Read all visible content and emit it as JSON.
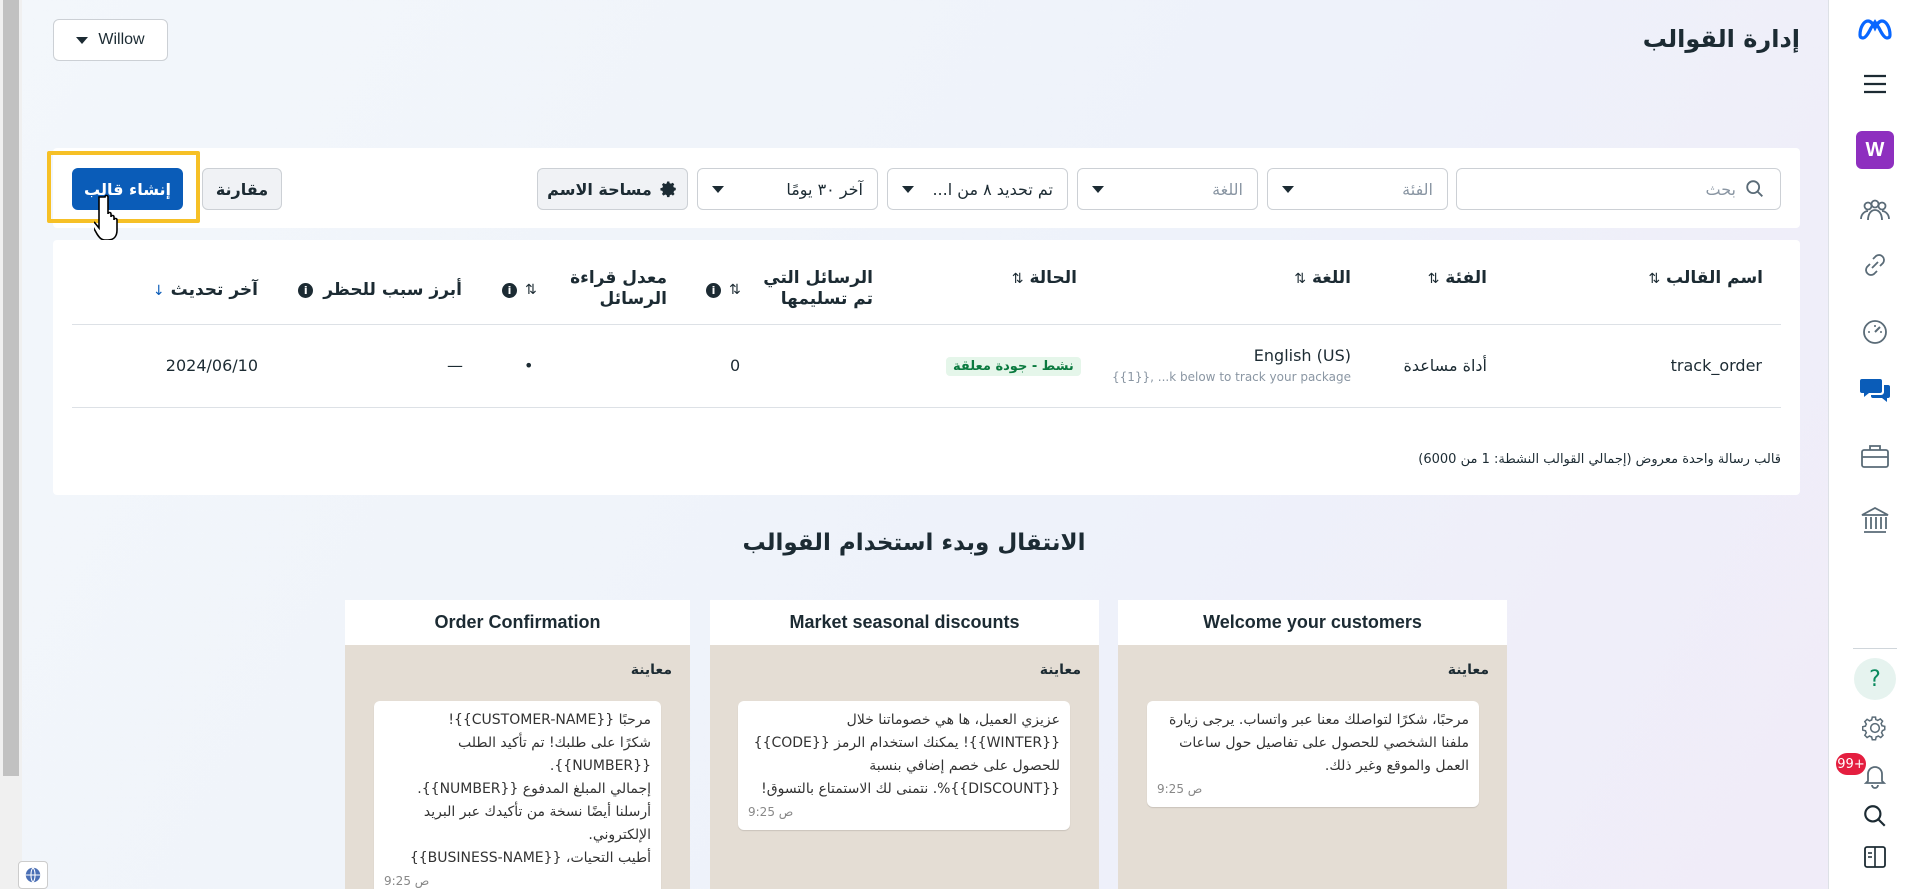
{
  "header": {
    "title": "إدارة القوالب",
    "account": "Willow"
  },
  "rail": {
    "workspace_letter": "W",
    "notification_count": "99+",
    "icons": [
      "meta-logo-icon",
      "menu-icon",
      "workspace-icon",
      "people-icon",
      "link-icon",
      "dashboard-gauge-icon",
      "chat-icon",
      "briefcase-icon",
      "bank-icon",
      "help-icon",
      "settings-icon",
      "bell-icon",
      "search-icon",
      "panel-icon"
    ]
  },
  "filters": {
    "search_placeholder": "بحث",
    "category_placeholder": "الفئة",
    "language_placeholder": "اللغة",
    "selected_value": "تم تحديد ٨ من ا...",
    "date_range": "آخر ٣٠ يومًا",
    "namespace_label": "مساحة الاسم",
    "compare_label": "مقارنة",
    "create_label": "إنشاء قالب"
  },
  "table": {
    "headers": {
      "name": "اسم القالب",
      "category": "الفئة",
      "language": "اللغة",
      "status": "الحالة",
      "delivered_line1": "الرسائل التي",
      "delivered_line2": "تم تسليمها",
      "readrate_line1": "معدل قراءة",
      "readrate_line2": "الرسائل",
      "block_reason": "أبرز سبب للحظر",
      "last_updated": "آخر تحديث"
    },
    "rows": [
      {
        "name": "track_order",
        "category": "أداة مساعدة",
        "language": "English (US)",
        "language_preview": "{{1}}, ...k below to track your package",
        "status": "نشط - جودة معلقة",
        "delivered": "0",
        "read_rate": "•",
        "block_reason": "—",
        "last_updated": "2024/06/10"
      }
    ],
    "footer": "قالب رسالة واحدة معروض (إجمالي القوالب النشطة: 1 من 6000)"
  },
  "templates_section": {
    "title": "الانتقال وبدء استخدام القوالب",
    "preview_label": "معاينة",
    "cards": [
      {
        "title": "Welcome your customers",
        "message": "مرحبًا، شكرًا لتواصلك معنا عبر واتساب. يرجى زيارة ملفنا الشخصي للحصول على تفاصيل حول ساعات العمل والموقع وغير ذلك.",
        "time": "9:25 ص"
      },
      {
        "title": "Market seasonal discounts",
        "message": "عزيزي العميل، ها هي خصوماتنا خلال {{WINTER}}! يمكنك استخدام الرمز {{CODE}} للحصول على خصم إضافي بنسبة {{DISCOUNT}}%. نتمنى لك الاستمتاع بالتسوق!",
        "time": "9:25 ص"
      },
      {
        "title": "Order Confirmation",
        "message": "مرحبًا {{CUSTOMER-NAME}}!\nشكرًا على طلبك! تم تأكيد الطلب {{NUMBER}}.\nإجمالي المبلغ المدفوع {{NUMBER}}.\nأرسلنا أيضًا نسخة من تأكيدك عبر البريد الإلكتروني.\nأطيب التحيات، {{BUSINESS-NAME}}",
        "time": "9:25 ص"
      }
    ]
  },
  "colors": {
    "primary": "#0a5cb8",
    "highlight": "#f6c026",
    "status_bg": "#e5f6ea",
    "status_text": "#0a7a3f"
  }
}
